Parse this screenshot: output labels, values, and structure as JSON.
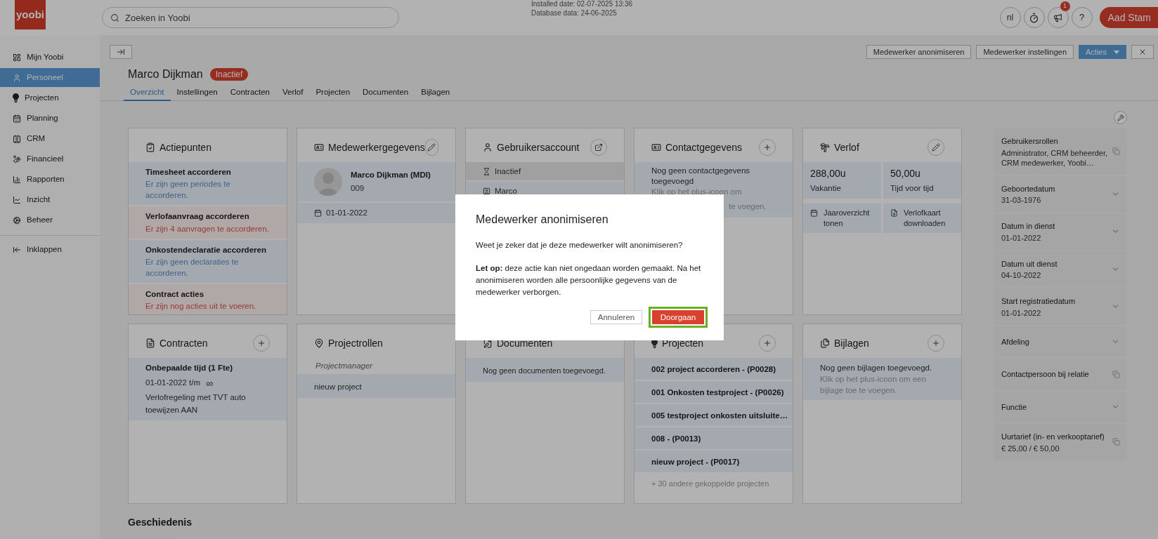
{
  "app": {
    "logo": "yoobi"
  },
  "search": {
    "placeholder": "Zoeken in Yoobi"
  },
  "install_info": [
    "Installed date: 02-07-2025 13:36",
    "Database data: 24-06-2025"
  ],
  "top_actions": {
    "language": "nl",
    "notification_badge": "1",
    "help": "?",
    "user": "Aad Stam"
  },
  "sidebar": {
    "items": [
      {
        "label": "Mijn Yoobi",
        "kind": "dashboard",
        "selected": false
      },
      {
        "label": "Personeel",
        "kind": "person",
        "selected": true
      },
      {
        "label": "Projecten",
        "kind": "projects",
        "selected": false
      },
      {
        "label": "Planning",
        "kind": "planning",
        "selected": false
      },
      {
        "label": "CRM",
        "kind": "crm",
        "selected": false
      },
      {
        "label": "Financieel",
        "kind": "finance",
        "selected": false
      },
      {
        "label": "Rapporten",
        "kind": "reports",
        "selected": false
      },
      {
        "label": "Inzicht",
        "kind": "insight",
        "selected": false
      },
      {
        "label": "Beheer",
        "kind": "admin",
        "selected": false
      }
    ],
    "collapse": "Inklappen"
  },
  "header": {
    "buttons": [
      "Medewerker anonimiseren",
      "Medewerker instellingen"
    ],
    "actions": "Acties",
    "name": "Marco Dijkman",
    "status": "Inactief"
  },
  "tabs": [
    {
      "label": "Overzicht",
      "selected": true
    },
    {
      "label": "Instellingen",
      "selected": false
    },
    {
      "label": "Contracten",
      "selected": false
    },
    {
      "label": "Verlof",
      "selected": false
    },
    {
      "label": "Projecten",
      "selected": false
    },
    {
      "label": "Documenten",
      "selected": false
    },
    {
      "label": "Bijlagen",
      "selected": false
    }
  ],
  "actiepunten": {
    "title": "Actiepunten",
    "items": [
      {
        "title": "Timesheet accorderen",
        "text": "Er zijn geen periodes te accorderen.",
        "kind": "info"
      },
      {
        "title": "Verlofaanvraag accorderen",
        "text": "Er zijn 4 aanvragen te accorderen.",
        "kind": "warning"
      },
      {
        "title": "Onkostendeclaratie accorderen",
        "text": "Er zijn geen declaraties te accorderen.",
        "kind": "info"
      },
      {
        "title": "Contract acties",
        "text": "Er zijn nog acties uit te voeren.",
        "kind": "warning"
      }
    ]
  },
  "medewerkergegevens": {
    "title": "Medewerkergegevens",
    "name": "Marco Dijkman (MDI)",
    "number": "009",
    "date": "01-01-2022"
  },
  "gebruikersaccount": {
    "title": "Gebruikersaccount",
    "rows": [
      {
        "label": "Inactief",
        "kind": "status"
      },
      {
        "label": "Marco",
        "kind": "name"
      }
    ]
  },
  "contactgegevens": {
    "title": "Contactgegevens",
    "text": "Nog geen contactgegevens toegevoegd",
    "hint_parts": [
      "Klik op het plus-icoon om",
      "te voegen."
    ]
  },
  "verlof": {
    "title": "Verlof",
    "balances": [
      {
        "value": "288,00u",
        "label": "Vakantie"
      },
      {
        "value": "50,00u",
        "label": "Tijd voor tijd"
      }
    ],
    "links": [
      {
        "label": "Jaaroverzicht tonen",
        "kind": "calendar"
      },
      {
        "label": "Verlofkaart downloaden",
        "kind": "pdf"
      }
    ]
  },
  "contracten": {
    "title": "Contracten",
    "name": "Onbepaalde tijd (1 Fte)",
    "period": "01-01-2022 t/m",
    "end": "∞",
    "description": "Verlofregeling met TVT auto toewijzen AAN"
  },
  "projectrollen": {
    "title": "Projectrollen",
    "role": "Projectmanager",
    "projects": [
      "nieuw project"
    ]
  },
  "documenten": {
    "title": "Documenten",
    "text": "Nog geen documenten toegevoegd."
  },
  "projecten": {
    "title": "Projecten",
    "items": [
      "002 project accorderen - (P0028)",
      "001 Onkosten testproject - (P0026)",
      "005 testproject onkosten uitsluite…",
      "008 - (P0013)",
      "nieuw project - (P0017)"
    ],
    "more": "+ 30 andere gekoppelde projecten"
  },
  "bijlagen": {
    "title": "Bijlagen",
    "text": "Nog geen bijlagen toegevoegd.",
    "hint": "Klik op het plus-icoon om een bijlage toe te voegen."
  },
  "details": [
    {
      "label": "Gebruikersrollen",
      "value": "Administrator, CRM beheerder, CRM medewerker, Yoobi…",
      "kind": "copy"
    },
    {
      "label": "Geboortedatum",
      "value": "31-03-1976",
      "kind": "dropdown"
    },
    {
      "label": "Datum in dienst",
      "value": "01-01-2022",
      "kind": "dropdown"
    },
    {
      "label": "Datum uit dienst",
      "value": "04-10-2022",
      "kind": "dropdown"
    },
    {
      "label": "Start registratiedatum",
      "value": "01-01-2022",
      "kind": "dropdown"
    },
    {
      "label": "Afdeling",
      "kind": "dropdown"
    },
    {
      "label": "Contactpersoon bij relatie",
      "kind": "copy"
    },
    {
      "label": "Functie",
      "kind": "dropdown"
    },
    {
      "label": "Uurtarief (in- en verkooptarief)",
      "value": "€ 25,00 / € 50,00",
      "kind": "copy"
    }
  ],
  "section_title": "Geschiedenis",
  "modal": {
    "title": "Medewerker anonimiseren",
    "question": "Weet je zeker dat je deze medewerker wilt anonimiseren?",
    "warning": "**Let op:** deze actie kan niet ongedaan worden gemaakt. Na het anonimiseren worden alle persoonlijke gegevens van de medewerker verborgen.",
    "buttons": [
      {
        "label": "Annuleren",
        "kind": "secondary",
        "highlighted": false
      },
      {
        "label": "Doorgaan",
        "kind": "primary",
        "highlighted": true
      }
    ]
  }
}
